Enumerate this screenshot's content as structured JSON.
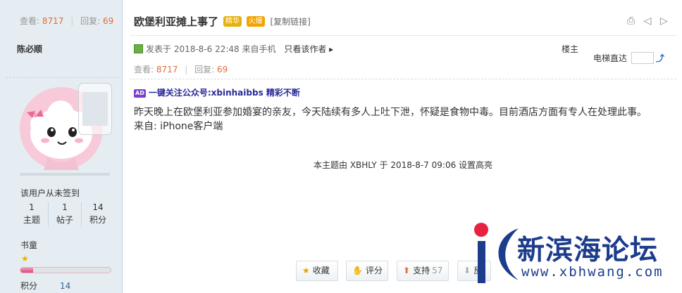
{
  "author": {
    "views_label": "查看:",
    "views": "8717",
    "replies_label": "回复:",
    "replies": "69",
    "name": "陈必顺",
    "signin_status": "该用户从未签到",
    "stats": [
      {
        "value": "1",
        "label": "主题"
      },
      {
        "value": "1",
        "label": "帖子"
      },
      {
        "value": "14",
        "label": "积分"
      }
    ],
    "rank": "书童",
    "rank_star": "★",
    "rank_progress": 0.14,
    "points_label": "积分",
    "points_value": "14"
  },
  "post": {
    "title": "欧堡利亚摊上事了",
    "medal_1": "精华",
    "medal_2": "火爆",
    "copy_link": "[复制链接]",
    "tools": "⎙ ◁ ▷",
    "posted_at": "发表于 2018-8-6 22:48",
    "source": "来自手机",
    "only_author": "只看该作者 ▸",
    "floor": "楼主",
    "elevator": "电梯直达",
    "views_label": "查看:",
    "views": "8717",
    "replies_label": "回复:",
    "replies": "69",
    "ad_tag": "AD",
    "ad_text": "一键关注公众号:xbinhaibbs 精彩不断",
    "body_line1": "昨天晚上在欧堡利亚参加婚宴的亲友，今天陆续有多人上吐下泄，怀疑是食物中毒。目前酒店方面有专人在处理此事。",
    "body_line2": "来自: iPhone客户端",
    "moderation_notice": "本主题由 XBHLY 于 2018-8-7 09:06 设置高亮"
  },
  "actions": {
    "favorite": "收藏",
    "rate": "评分",
    "support": "支持",
    "support_count": "57",
    "oppose": "反"
  },
  "watermark": {
    "name": "新滨海论坛",
    "url": "www.xbhwang.com"
  },
  "colors": {
    "sidebar_bg": "#e5edf2",
    "count_accent": "#e06c3c",
    "watermark_blue": "#1c3c8c",
    "watermark_red": "#e8213f"
  }
}
